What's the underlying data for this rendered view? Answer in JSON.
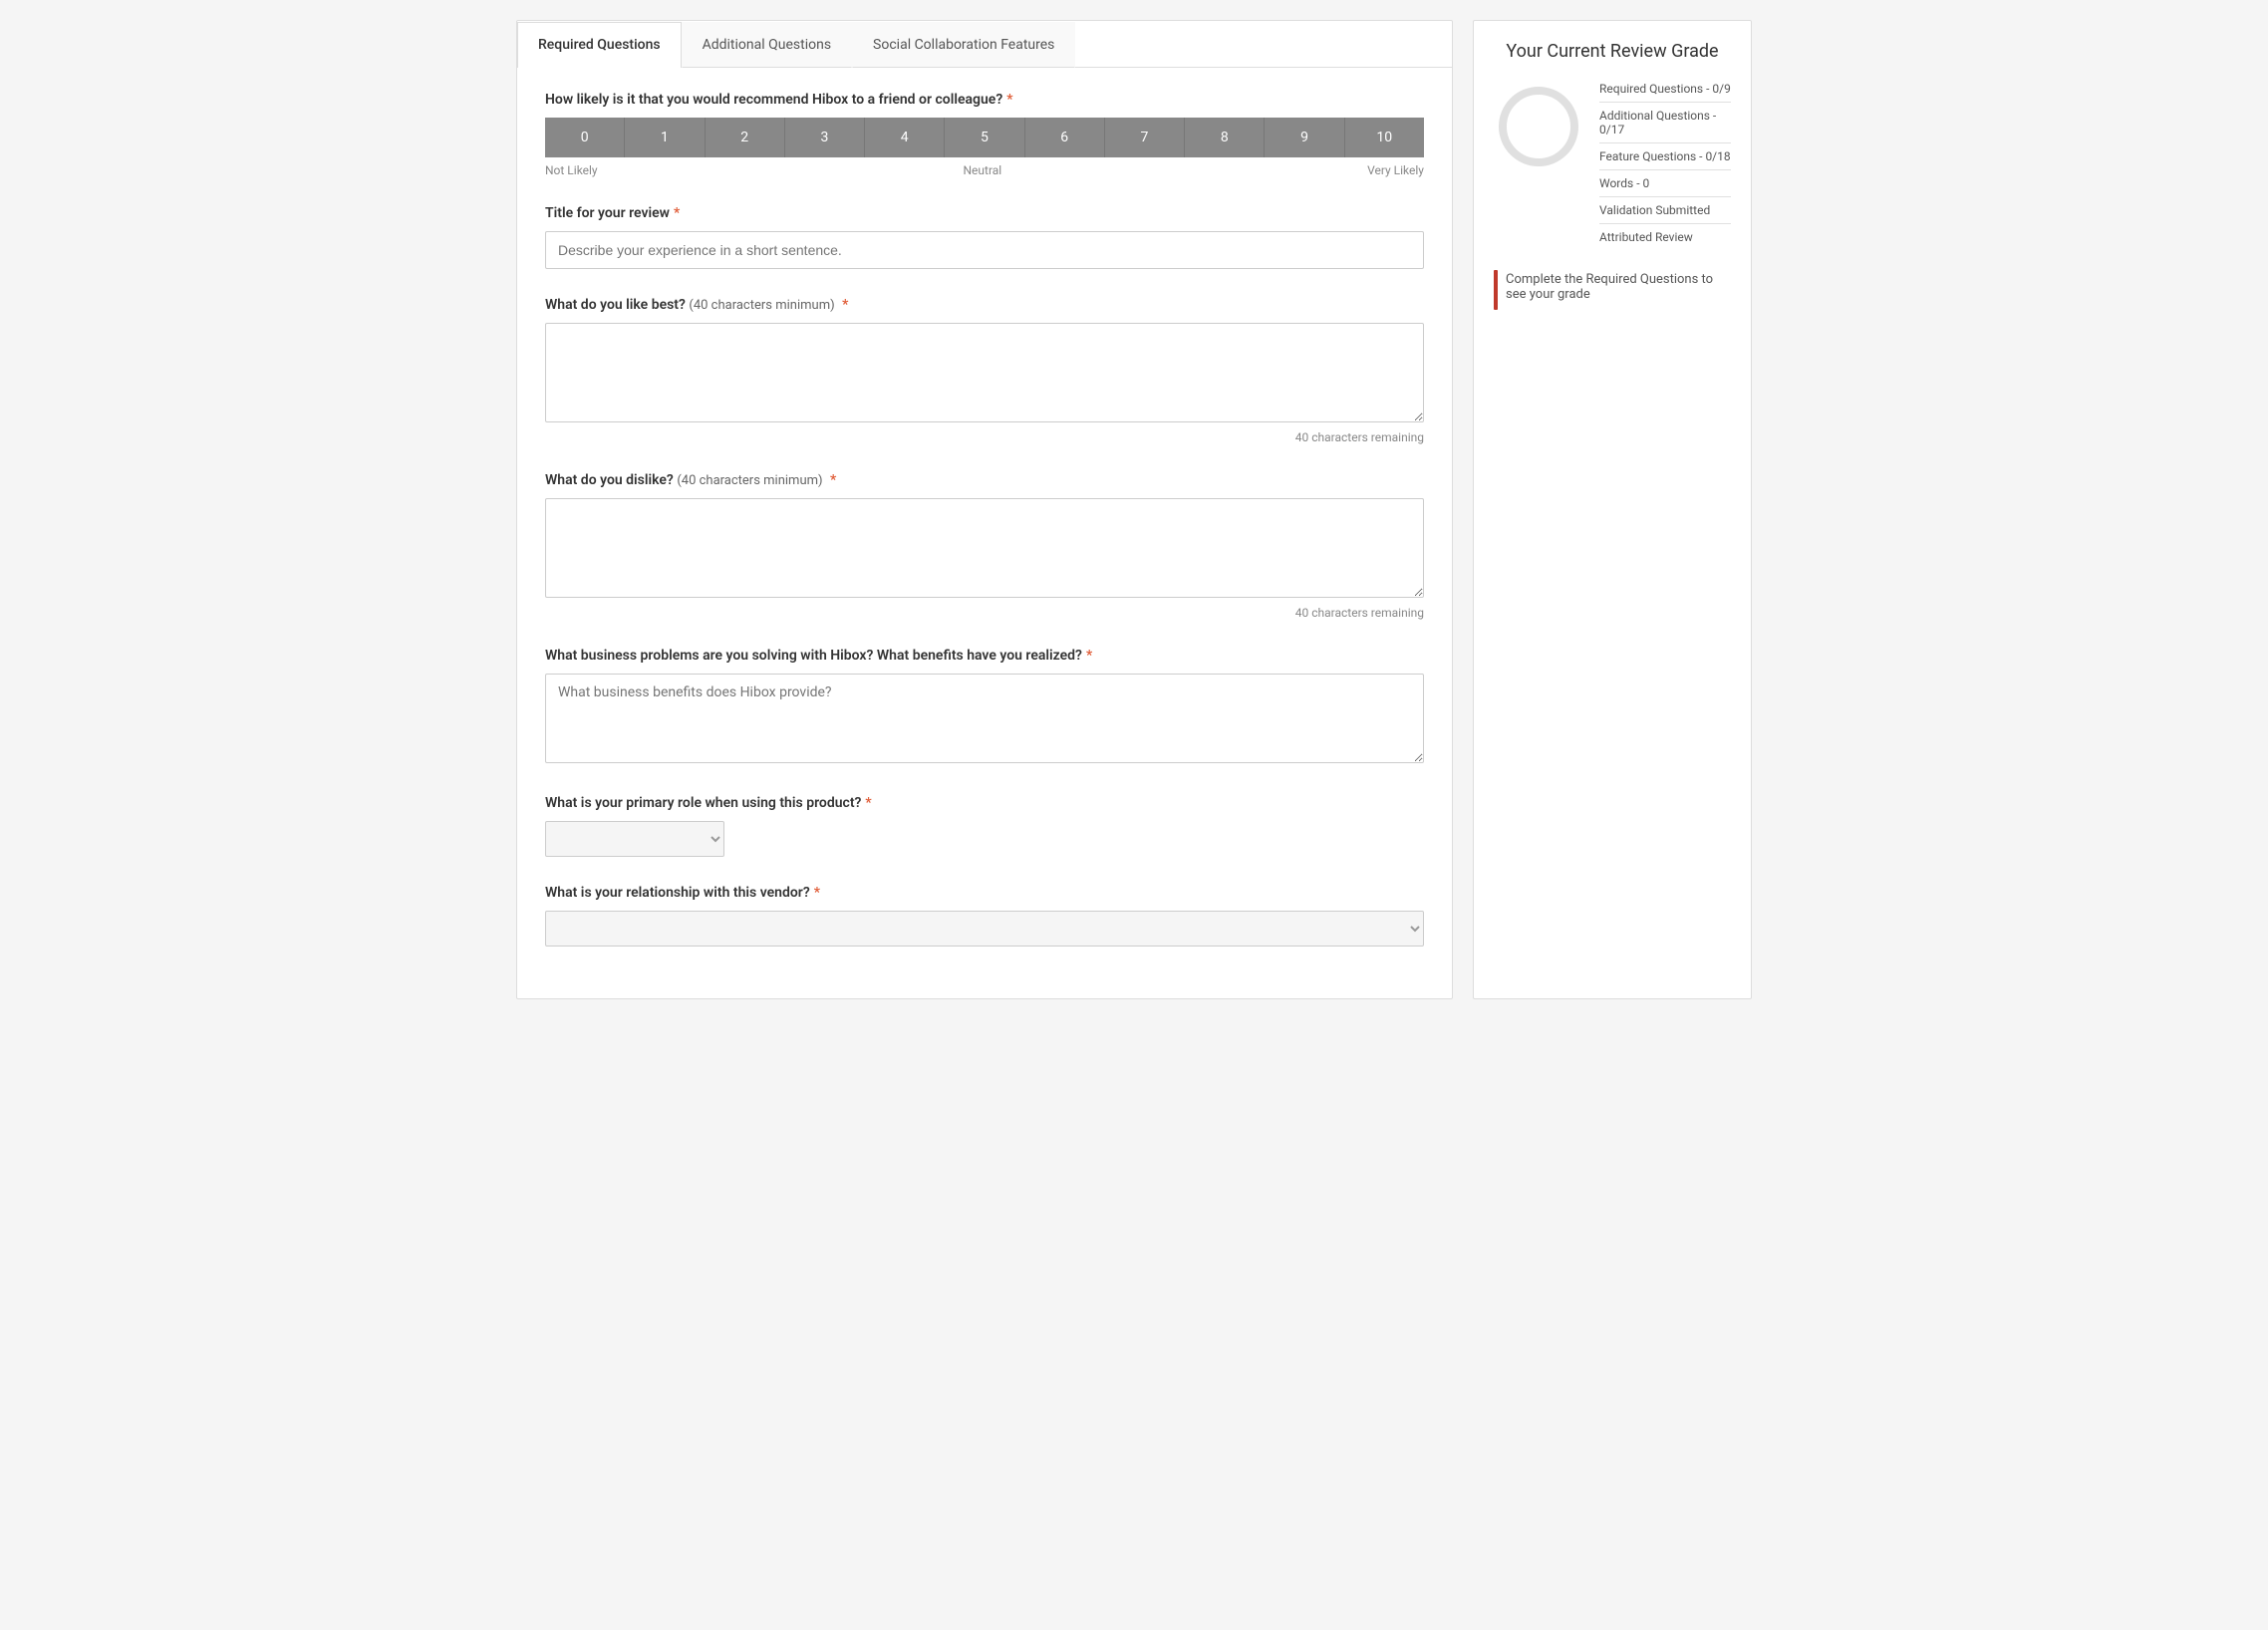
{
  "tabs": [
    {
      "id": "required",
      "label": "Required Questions",
      "active": true
    },
    {
      "id": "additional",
      "label": "Additional Questions",
      "active": false
    },
    {
      "id": "social",
      "label": "Social Collaboration Features",
      "active": false
    }
  ],
  "form": {
    "q1_label": "How likely is it that you would recommend Hibox to a friend or colleague?",
    "q1_req": "*",
    "rating_values": [
      "0",
      "1",
      "2",
      "3",
      "4",
      "5",
      "6",
      "7",
      "8",
      "9",
      "10"
    ],
    "rating_label_left": "Not Likely",
    "rating_label_mid": "Neutral",
    "rating_label_right": "Very Likely",
    "q2_label": "Title for your review",
    "q2_req": "*",
    "q2_placeholder": "Describe your experience in a short sentence.",
    "q3_label": "What do you like best?",
    "q3_hint": "(40 characters minimum)",
    "q3_req": "*",
    "q3_char_remaining": "40 characters remaining",
    "q4_label": "What do you dislike?",
    "q4_hint": "(40 characters minimum)",
    "q4_req": "*",
    "q4_char_remaining": "40 characters remaining",
    "q5_label": "What business problems are you solving with Hibox? What benefits have you realized?",
    "q5_req": "*",
    "q5_placeholder": "What business benefits does Hibox provide?",
    "q6_label": "What is your primary role when using this product?",
    "q6_req": "*",
    "q7_label": "What is your relationship with this vendor?",
    "q7_req": "*"
  },
  "sidebar": {
    "title": "Your Current Review Grade",
    "grade_items": [
      {
        "label": "Required Questions - 0/9"
      },
      {
        "label": "Additional Questions - 0/17"
      },
      {
        "label": "Feature Questions - 0/18"
      },
      {
        "label": "Words - 0"
      },
      {
        "label": "Validation Submitted"
      },
      {
        "label": "Attributed Review"
      }
    ],
    "notice": "Complete the Required Questions to see your grade"
  }
}
